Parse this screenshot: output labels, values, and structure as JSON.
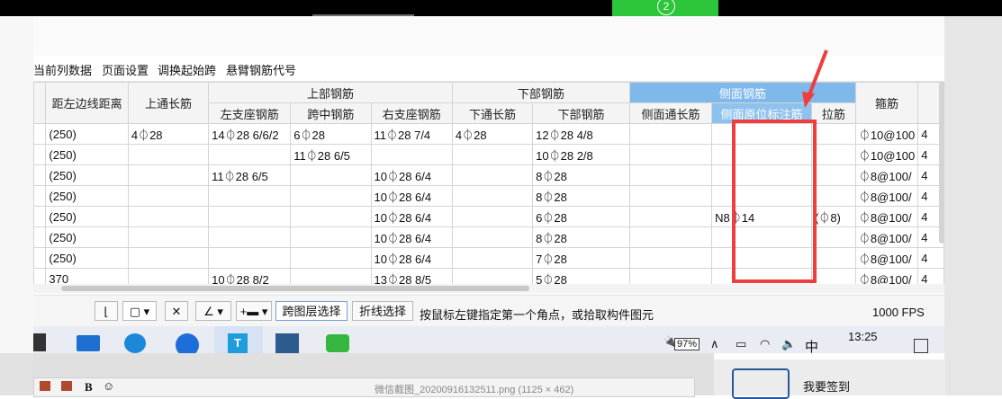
{
  "video_tab": {
    "number": "2"
  },
  "menu": {
    "items": [
      "当前列数据",
      "页面设置",
      "调换起始跨",
      "悬臂钢筋代号"
    ]
  },
  "table": {
    "header_groups": {
      "top_rebar": "上部钢筋",
      "bottom_rebar": "下部钢筋",
      "side_rebar": "侧面钢筋"
    },
    "columns": {
      "left_partial": ")",
      "dist_left_edge": "距左边线距离",
      "top_through": "上通长筋",
      "left_support": "左支座钢筋",
      "mid_span": "跨中钢筋",
      "right_support": "右支座钢筋",
      "bottom_through": "下通长筋",
      "bottom_rebar": "下部钢筋",
      "side_through": "侧面通长筋",
      "side_original_label": "侧面原位标注筋",
      "tie": "拉筋",
      "stirrup": "箍筋"
    },
    "rows": [
      {
        "dist": "(250)",
        "top_through": "4⏀28",
        "left_support": "14⏀28 6/6/2",
        "mid_span": "6⏀28",
        "right_support": "11⏀28 7/4",
        "bottom_through": "4⏀28",
        "bottom": "12⏀28 4/8",
        "side_through": "",
        "side_label": "",
        "tie": "",
        "stirrup": "⏀10@100",
        "extra": "4"
      },
      {
        "dist": "(250)",
        "top_through": "",
        "left_support": "",
        "mid_span": "11⏀28 6/5",
        "right_support": "",
        "bottom_through": "",
        "bottom": "10⏀28 2/8",
        "side_through": "",
        "side_label": "",
        "tie": "",
        "stirrup": "⏀10@100",
        "extra": "4"
      },
      {
        "dist": "(250)",
        "top_through": "",
        "left_support": "11⏀28 6/5",
        "mid_span": "",
        "right_support": "10⏀28 6/4",
        "bottom_through": "",
        "bottom": "8⏀28",
        "side_through": "",
        "side_label": "",
        "tie": "",
        "stirrup": "⏀8@100/",
        "extra": "4"
      },
      {
        "dist": "(250)",
        "top_through": "",
        "left_support": "",
        "mid_span": "",
        "right_support": "10⏀28 6/4",
        "bottom_through": "",
        "bottom": "8⏀28",
        "side_through": "",
        "side_label": "",
        "tie": "",
        "stirrup": "⏀8@100/",
        "extra": "4"
      },
      {
        "dist": "(250)",
        "top_through": "",
        "left_support": "",
        "mid_span": "",
        "right_support": "10⏀28 6/4",
        "bottom_through": "",
        "bottom": "6⏀28",
        "side_through": "",
        "side_label": "N8⏀14",
        "tie": "(⏀8)",
        "stirrup": "⏀8@100/",
        "extra": "4"
      },
      {
        "dist": "(250)",
        "top_through": "",
        "left_support": "",
        "mid_span": "",
        "right_support": "10⏀28 6/4",
        "bottom_through": "",
        "bottom": "8⏀28",
        "side_through": "",
        "side_label": "",
        "tie": "",
        "stirrup": "⏀8@100/",
        "extra": "4"
      },
      {
        "dist": "(250)",
        "top_through": "",
        "left_support": "",
        "mid_span": "",
        "right_support": "10⏀28 6/4",
        "bottom_through": "",
        "bottom": "7⏀28",
        "side_through": "",
        "side_label": "",
        "tie": "",
        "stirrup": "⏀8@100/",
        "extra": "4"
      },
      {
        "dist": "370",
        "top_through": "",
        "left_support": "10⏀28 8/2",
        "mid_span": "",
        "right_support": "13⏀28 8/5",
        "bottom_through": "",
        "bottom": "5⏀28",
        "side_through": "",
        "side_label": "",
        "tie": "",
        "stirrup": "⏀8@100/",
        "extra": "4"
      }
    ]
  },
  "toolbar": {
    "span_layer_select": "跨图层选择",
    "polyline_select": "折线选择",
    "hint": "按鼠标左键指定第一个角点，或拾取构件图元",
    "fps": "1000 FPS"
  },
  "taskbar": {
    "battery": "97%",
    "ime": "中",
    "time": "13:25"
  },
  "below": {
    "checkin": "我要签到",
    "file_hint": "微信截图_20200916132511.png (1125 × 462)"
  },
  "colors": {
    "header_blue": "#7fb8ea",
    "annotation_red": "#ee3e3e",
    "video_green": "#2dc63a"
  }
}
